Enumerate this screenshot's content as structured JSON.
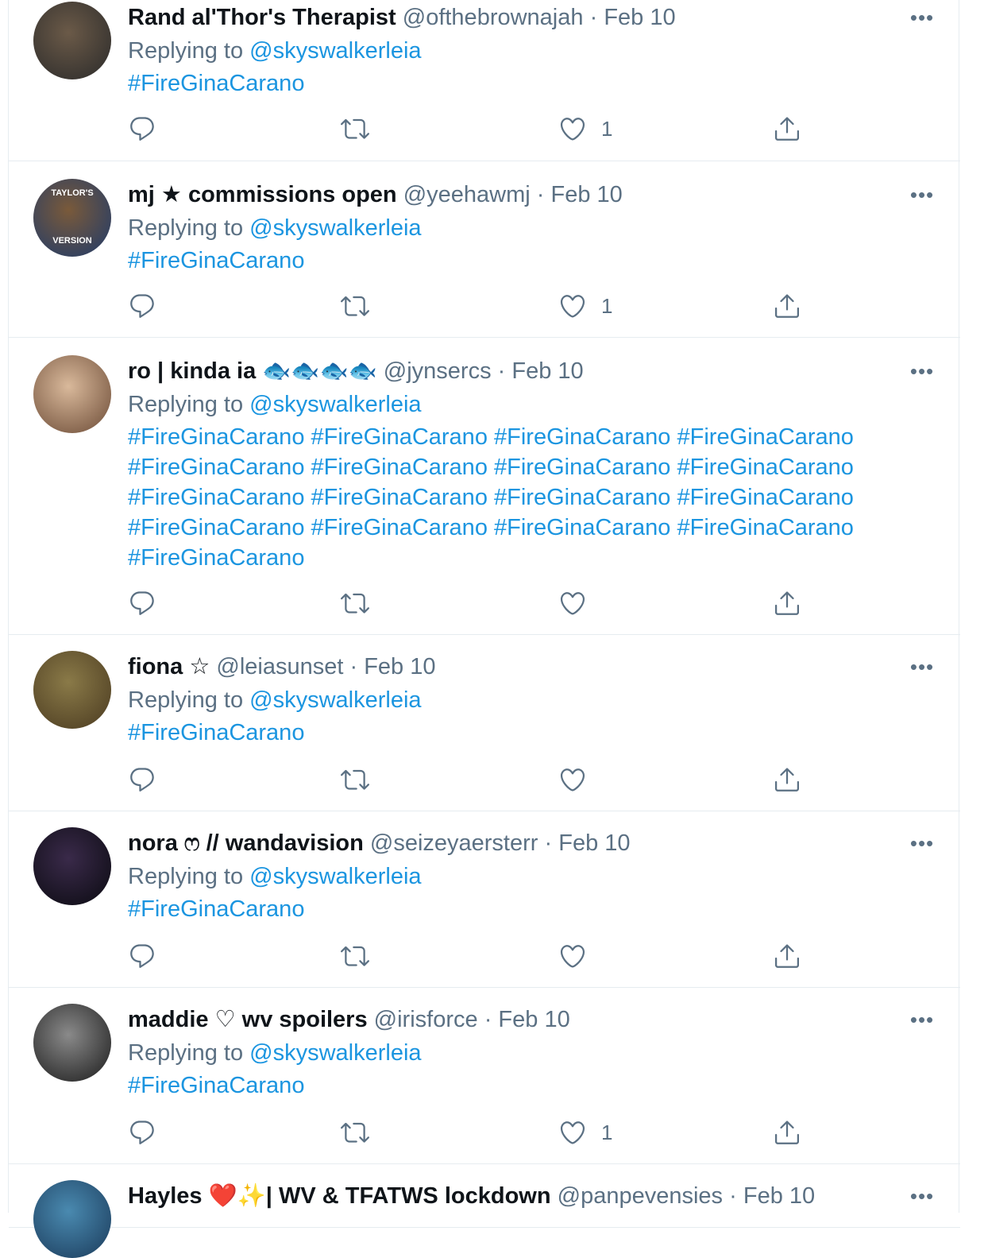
{
  "tweets": [
    {
      "name": "Rand al'Thor's Therapist",
      "handle": "@ofthebrownajah",
      "sep": "·",
      "date": "Feb 10",
      "replying_prefix": "Replying to ",
      "replying_to": "@skyswalkerleia",
      "text": "#FireGinaCarano",
      "likes": "1",
      "avatar_colors": [
        "#6b5a48",
        "#2a2a2a"
      ]
    },
    {
      "name": "mj ★ commissions open",
      "handle": "@yeehawmj",
      "sep": "·",
      "date": "Feb 10",
      "replying_prefix": "Replying to ",
      "replying_to": "@skyswalkerleia",
      "text": "#FireGinaCarano",
      "likes": "1",
      "avatar_colors": [
        "#7a5a3a",
        "#1e3a6a"
      ],
      "avatar_badge_top": "TAYLOR'S",
      "avatar_badge_bottom": "VERSION"
    },
    {
      "name": "ro | kinda ia 🐟🐟🐟🐟",
      "handle": "@jynsercs",
      "sep": "·",
      "date": "Feb 10",
      "replying_prefix": "Replying to ",
      "replying_to": "@skyswalkerleia",
      "text": "#FireGinaCarano #FireGinaCarano #FireGinaCarano #FireGinaCarano #FireGinaCarano #FireGinaCarano #FireGinaCarano #FireGinaCarano #FireGinaCarano #FireGinaCarano #FireGinaCarano #FireGinaCarano #FireGinaCarano #FireGinaCarano #FireGinaCarano #FireGinaCarano #FireGinaCarano",
      "likes": "",
      "avatar_colors": [
        "#d9b99b",
        "#6b4a35"
      ]
    },
    {
      "name": "fiona ☆",
      "handle": "@leiasunset",
      "sep": "·",
      "date": "Feb 10",
      "replying_prefix": "Replying to ",
      "replying_to": "@skyswalkerleia",
      "text": "#FireGinaCarano",
      "likes": "",
      "avatar_colors": [
        "#8a7a48",
        "#4a3a20"
      ]
    },
    {
      "name": "nora ෆ // wandavision",
      "handle": "@seizeyaersterr",
      "sep": "·",
      "date": "Feb 10",
      "replying_prefix": "Replying to ",
      "replying_to": "@skyswalkerleia",
      "text": "#FireGinaCarano",
      "likes": "",
      "avatar_colors": [
        "#3a2a4a",
        "#0a0a10"
      ]
    },
    {
      "name": "maddie ♡ wv spoilers",
      "handle": "@irisforce",
      "sep": "·",
      "date": "Feb 10",
      "replying_prefix": "Replying to ",
      "replying_to": "@skyswalkerleia",
      "text": "#FireGinaCarano",
      "likes": "1",
      "avatar_colors": [
        "#8a8a8a",
        "#1a1a1a"
      ]
    },
    {
      "name": "Hayles ❤️✨| WV & TFATWS lockdown",
      "handle": "@panpevensies",
      "sep": "·",
      "date": "Feb 10",
      "replying_prefix": "",
      "replying_to": "",
      "text": "",
      "likes": "",
      "avatar_colors": [
        "#4a8ab0",
        "#1a3a5a"
      ]
    }
  ],
  "more_label": "•••",
  "icons": [
    "reply-icon",
    "retweet-icon",
    "like-icon",
    "share-icon",
    "more-icon"
  ]
}
